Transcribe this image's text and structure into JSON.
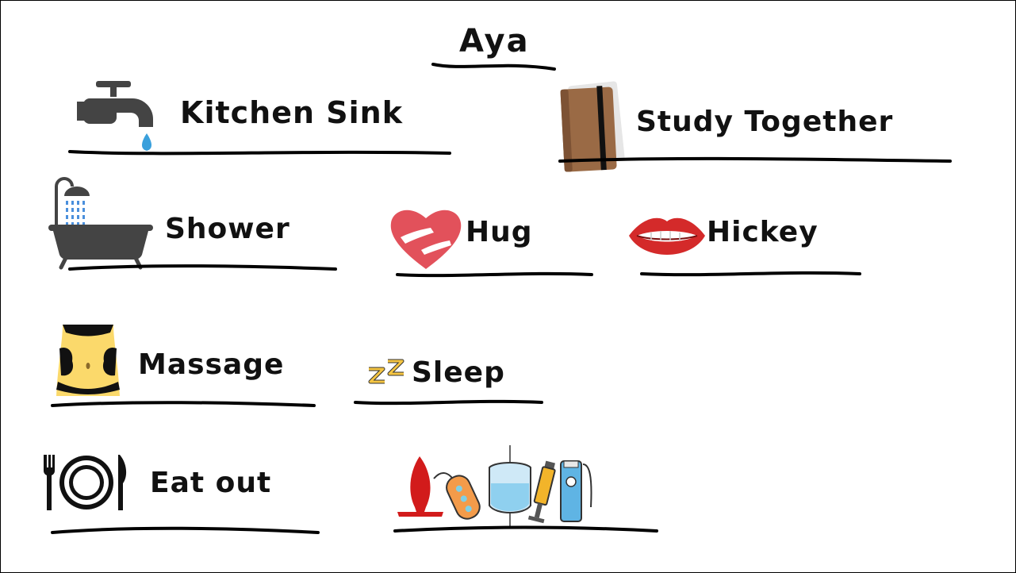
{
  "title": "Aya",
  "items": [
    {
      "label": "Kitchen Sink",
      "icon": "faucet-icon"
    },
    {
      "label": "Study Together",
      "icon": "notebook-icon"
    },
    {
      "label": "Shower",
      "icon": "bathtub-shower-icon"
    },
    {
      "label": "Hug",
      "icon": "heart-hug-icon"
    },
    {
      "label": "Hickey",
      "icon": "lips-icon"
    },
    {
      "label": "Massage",
      "icon": "massage-belly-icon"
    },
    {
      "label": "Sleep",
      "icon": "zzz-icon"
    },
    {
      "label": "Eat out",
      "icon": "plate-fork-knife-icon"
    },
    {
      "label": "",
      "icon": "toys-icons"
    }
  ]
}
